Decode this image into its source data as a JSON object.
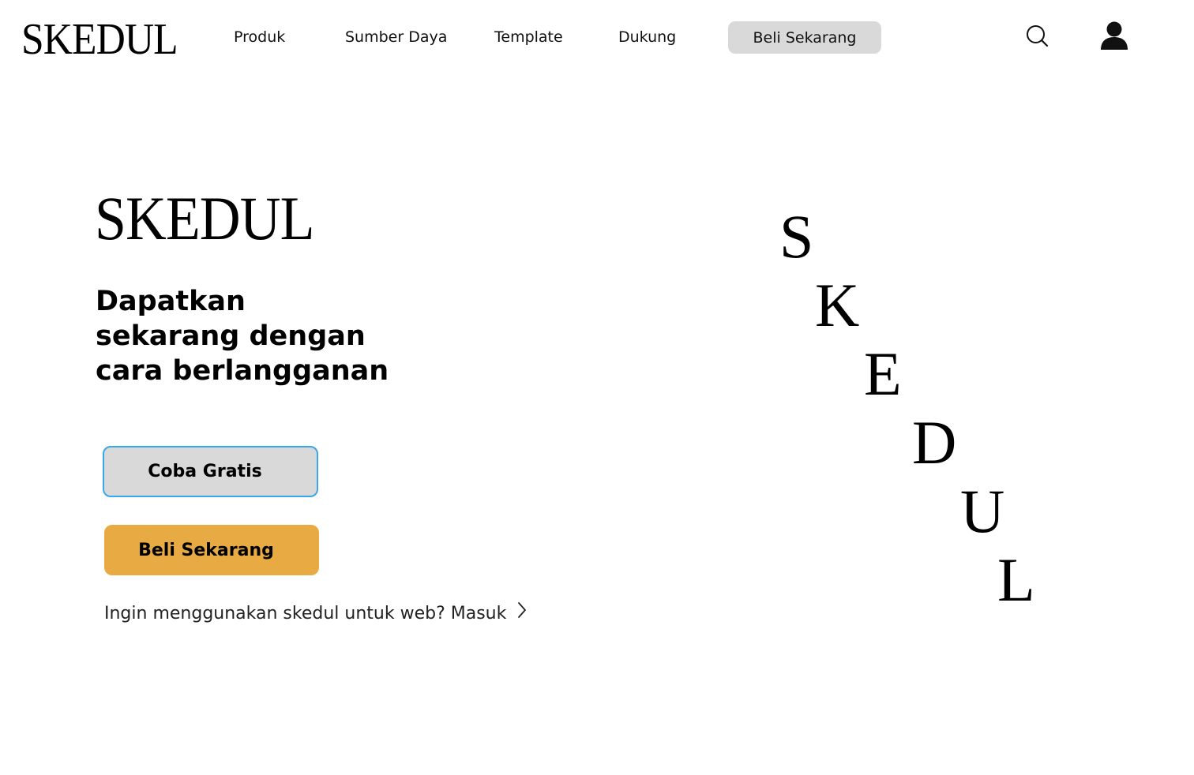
{
  "header": {
    "logo": "SKEDUL",
    "nav": {
      "produk": "Produk",
      "sumber_daya": "Sumber Daya",
      "template": "Template",
      "dukung": "Dukung",
      "beli": "Beli Sekarang"
    },
    "icons": {
      "search": "search-icon",
      "account": "user-icon"
    }
  },
  "hero": {
    "logo": "SKEDUL",
    "headline": [
      "Dapatkan",
      "sekarang dengan",
      "cara berlangganan"
    ],
    "trial_button": "Coba Gratis",
    "buy_button": "Beli Sekarang",
    "web_link": "Ingin menggunakan skedul untuk web? Masuk"
  },
  "decor": {
    "letters": [
      "S",
      "K",
      "E",
      "D",
      "U",
      "L"
    ]
  },
  "colors": {
    "nav_button_bg": "#d9d9d9",
    "trial_button_bg": "#d9d9d9",
    "trial_button_border": "#3aa7ea",
    "buy_button_bg": "#e8aa42",
    "text": "#111111"
  }
}
